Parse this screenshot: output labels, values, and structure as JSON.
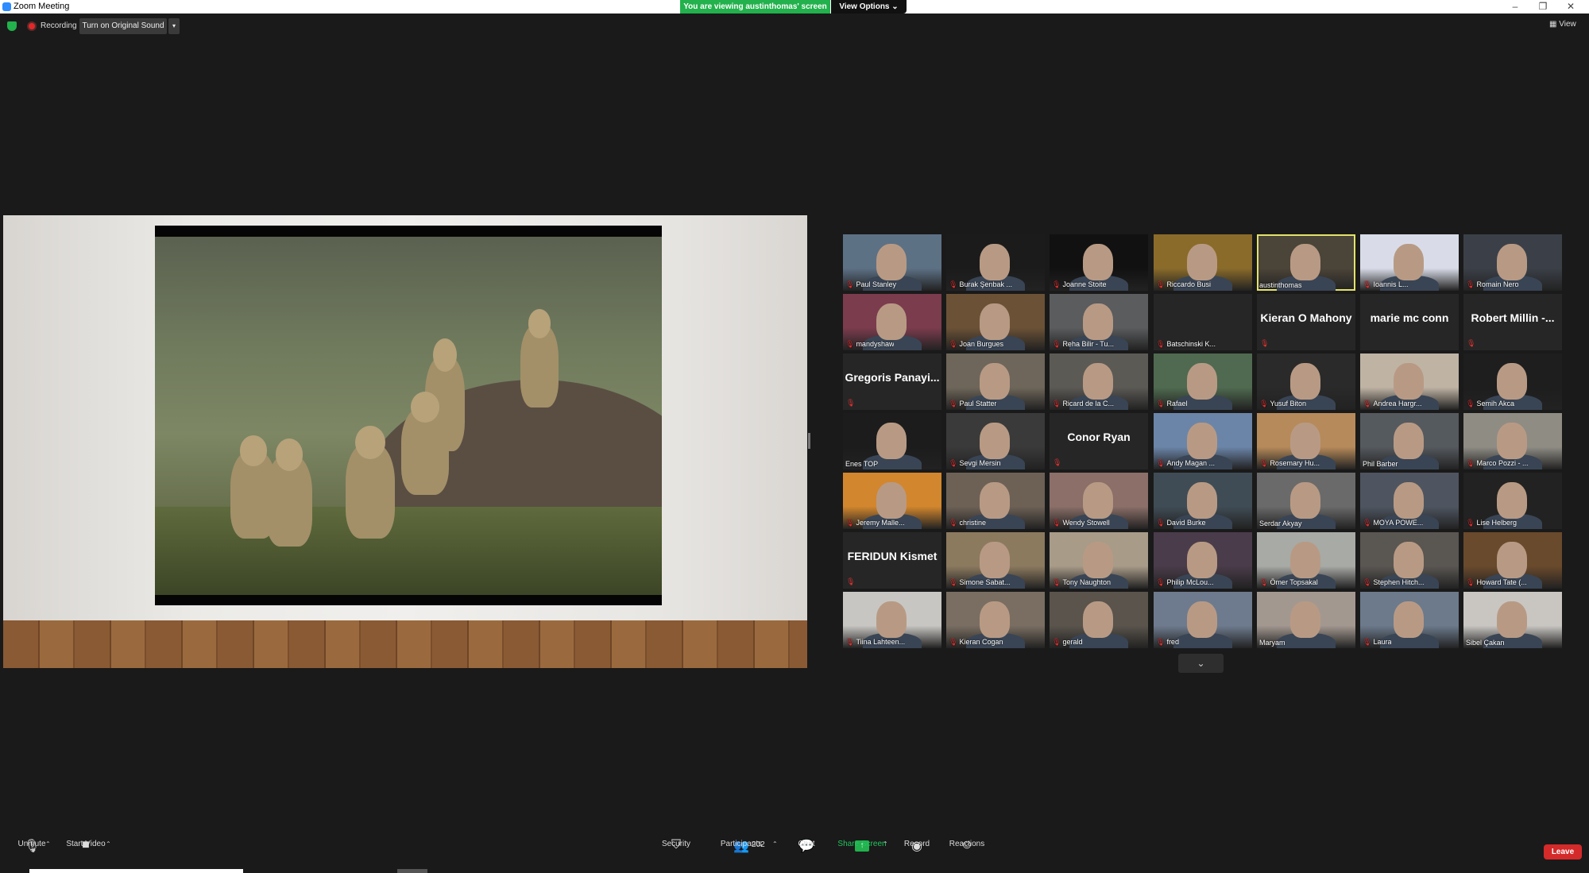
{
  "window": {
    "title": "Zoom Meeting",
    "viewing_banner": "You are viewing austinthomas' screen",
    "view_options": "View Options ⌄",
    "controls": [
      "–",
      "❐",
      "✕"
    ]
  },
  "top_bar": {
    "recording_label": "Recording",
    "original_sound_button": "Turn on Original Sound",
    "original_sound_dropdown": "▾",
    "view_label": "▦ View"
  },
  "gallery": {
    "tiles": [
      {
        "name": "Paul Stanley",
        "muted": true,
        "video": true,
        "bg": "#5d7185"
      },
      {
        "name": "Burak Şenbak ...",
        "muted": true,
        "video": true,
        "bg": "#1b1b1b"
      },
      {
        "name": "Joanne Stoite",
        "muted": true,
        "video": true,
        "bg": "#111111"
      },
      {
        "name": "Riccardo Busi",
        "muted": true,
        "video": true,
        "bg": "#8a6b2a"
      },
      {
        "name": "austinthomas",
        "muted": false,
        "video": true,
        "bg": "#4b4438",
        "active": true
      },
      {
        "name": "Ioannis L...",
        "muted": true,
        "video": true,
        "bg": "#d9dce8"
      },
      {
        "name": "Romain Nero",
        "muted": true,
        "video": true,
        "bg": "#3b4048"
      },
      {
        "name": "mandyshaw",
        "muted": true,
        "video": true,
        "bg": "#7b3c4e"
      },
      {
        "name": "Joan Burgues",
        "muted": true,
        "video": true,
        "bg": "#6b5236"
      },
      {
        "name": "Reha Bilir - Tu...",
        "muted": true,
        "video": true,
        "bg": "#5a5c5e"
      },
      {
        "name": "Batschinski K...",
        "muted": true,
        "video": false,
        "bg": "#0e0e0e"
      },
      {
        "name": "",
        "display": "Kieran O Mahony",
        "muted": true,
        "video": false
      },
      {
        "name": "",
        "display": "marie mc conn",
        "muted": false,
        "video": false
      },
      {
        "name": "",
        "display": "Robert Millin -...",
        "muted": true,
        "video": false
      },
      {
        "name": "",
        "display": "Gregoris Panayi...",
        "muted": true,
        "video": false
      },
      {
        "name": "Paul Statter",
        "muted": true,
        "video": true,
        "bg": "#6e665a"
      },
      {
        "name": "Ricard de la C...",
        "muted": true,
        "video": true,
        "bg": "#5c5a55"
      },
      {
        "name": "Rafael",
        "muted": true,
        "video": true,
        "bg": "#4f6a50"
      },
      {
        "name": "Yusuf Biton",
        "muted": true,
        "video": true,
        "bg": "#2a2a2a"
      },
      {
        "name": "Andrea Hargr...",
        "muted": true,
        "video": true,
        "bg": "#bfb3a4"
      },
      {
        "name": "Semih Akca",
        "muted": true,
        "video": true,
        "bg": "#1e1e1e"
      },
      {
        "name": "Enes TOP",
        "muted": false,
        "video": true,
        "bg": "#1c1c1c"
      },
      {
        "name": "Sevgi Mersin",
        "muted": true,
        "video": true,
        "bg": "#3a3a3a"
      },
      {
        "name": "",
        "display": "Conor Ryan",
        "muted": true,
        "video": false
      },
      {
        "name": "Andy Magan ...",
        "muted": true,
        "video": true,
        "bg": "#6b85a8"
      },
      {
        "name": "Rosemary Hu...",
        "muted": true,
        "video": true,
        "bg": "#b68a5a"
      },
      {
        "name": "Phil Barber",
        "muted": false,
        "video": true,
        "bg": "#555a5e"
      },
      {
        "name": "Marco Pozzi - ...",
        "muted": true,
        "video": true,
        "bg": "#8f8c84"
      },
      {
        "name": "Jeremy Malle...",
        "muted": true,
        "video": true,
        "bg": "#d2862e"
      },
      {
        "name": "christine",
        "muted": true,
        "video": true,
        "bg": "#6d6156"
      },
      {
        "name": "Wendy Stowell",
        "muted": true,
        "video": true,
        "bg": "#8b6f68"
      },
      {
        "name": "David Burke",
        "muted": true,
        "video": true,
        "bg": "#3f4c55"
      },
      {
        "name": "Serdar Akyay",
        "muted": false,
        "video": true,
        "bg": "#6a6a6a"
      },
      {
        "name": "MOYA POWE...",
        "muted": true,
        "video": true,
        "bg": "#4e5560"
      },
      {
        "name": "Lise Helberg",
        "muted": true,
        "video": true,
        "bg": "#222222"
      },
      {
        "name": "",
        "display": "FERIDUN Kismet",
        "muted": true,
        "video": false
      },
      {
        "name": "Simone Sabat...",
        "muted": true,
        "video": true,
        "bg": "#8c7a5f"
      },
      {
        "name": "Tony Naughton",
        "muted": true,
        "video": true,
        "bg": "#a89b88"
      },
      {
        "name": "Philip McLou...",
        "muted": true,
        "video": true,
        "bg": "#4a3c4a"
      },
      {
        "name": "Ömer Topsakal",
        "muted": true,
        "video": true,
        "bg": "#a8aaa6"
      },
      {
        "name": "Stephen Hitch...",
        "muted": true,
        "video": true,
        "bg": "#5a5652"
      },
      {
        "name": "Howard Tate (...",
        "muted": true,
        "video": true,
        "bg": "#6a4a2c"
      },
      {
        "name": "Tiina Lahteen...",
        "muted": true,
        "video": true,
        "bg": "#c8c6c2"
      },
      {
        "name": "Kieran Cogan",
        "muted": true,
        "video": true,
        "bg": "#7a6e62"
      },
      {
        "name": "gerald",
        "muted": true,
        "video": true,
        "bg": "#5a544c"
      },
      {
        "name": "fred",
        "muted": true,
        "video": true,
        "bg": "#6e7b8e"
      },
      {
        "name": "Maryam",
        "muted": false,
        "video": true,
        "bg": "#a39890"
      },
      {
        "name": "Laura",
        "muted": true,
        "video": true,
        "bg": "#6c7a8c"
      },
      {
        "name": "Sibel Çakan",
        "muted": false,
        "video": true,
        "bg": "#c9c6c2"
      }
    ],
    "scroll_down": "⌄"
  },
  "toolbar": {
    "unmute": "Unmute",
    "start_video": "Start Video",
    "security": "Security",
    "participants": "Participants",
    "participants_count": "202",
    "chat": "Chat",
    "share_screen": "Share Screen",
    "record": "Record",
    "reactions": "Reactions",
    "leave": "Leave",
    "caret": "⌃",
    "icons": {
      "unmute": "mic-off-icon",
      "start_video": "video-off-icon",
      "security": "shield-icon",
      "participants": "people-icon",
      "chat": "chat-bubble-icon",
      "share_screen": "share-arrow-icon",
      "record": "record-icon",
      "reactions": "smiley-icon"
    }
  },
  "colors": {
    "accent_green": "#22b14c",
    "leave_red": "#d42a2a",
    "muted_red": "#e03030",
    "active_speaker_border": "#e3e36b"
  }
}
